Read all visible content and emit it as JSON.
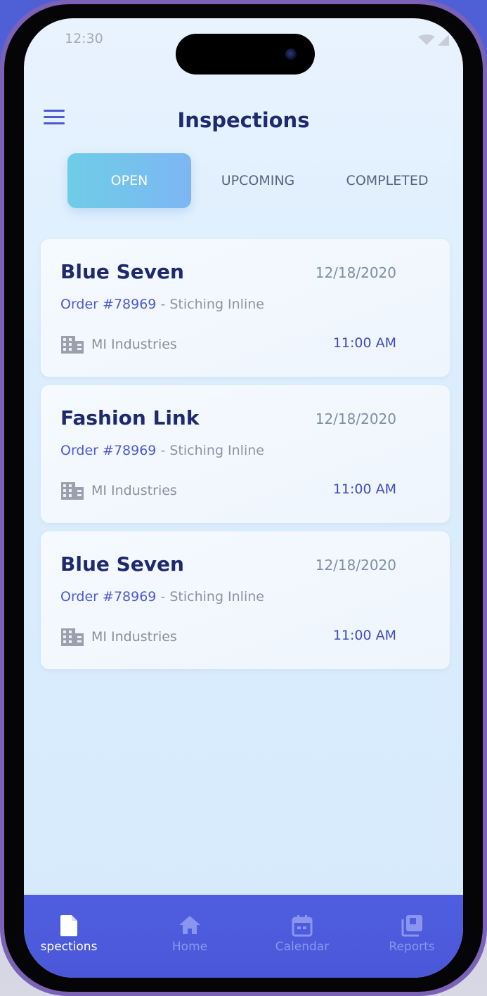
{
  "status_bar": {
    "time": "12:30"
  },
  "header": {
    "title": "Inspections"
  },
  "tabs": [
    {
      "label": "OPEN",
      "active": true
    },
    {
      "label": "UPCOMING",
      "active": false
    },
    {
      "label": "COMPLETED",
      "active": false
    }
  ],
  "inspections": [
    {
      "title": "Blue Seven",
      "date": "12/18/2020",
      "order_number": "Order #78969",
      "order_type": " - Stiching Inline",
      "company": "MI Industries",
      "time": "11:00 AM"
    },
    {
      "title": "Fashion Link",
      "date": "12/18/2020",
      "order_number": "Order #78969",
      "order_type": " - Stiching Inline",
      "company": "MI Industries",
      "time": "11:00 AM"
    },
    {
      "title": "Blue Seven",
      "date": "12/18/2020",
      "order_number": "Order #78969",
      "order_type": " - Stiching Inline",
      "company": "MI Industries",
      "time": "11:00 AM"
    }
  ],
  "bottom_nav": [
    {
      "label": "spections",
      "icon": "document-icon",
      "active": true
    },
    {
      "label": "Home",
      "icon": "home-icon",
      "active": false
    },
    {
      "label": "Calendar",
      "icon": "calendar-icon",
      "active": false
    },
    {
      "label": "Reports",
      "icon": "reports-icon",
      "active": false
    }
  ],
  "colors": {
    "accent": "#4a58d8",
    "title": "#1f2a6e",
    "tab_active_start": "#6ecde6",
    "tab_active_end": "#7db6f3"
  }
}
